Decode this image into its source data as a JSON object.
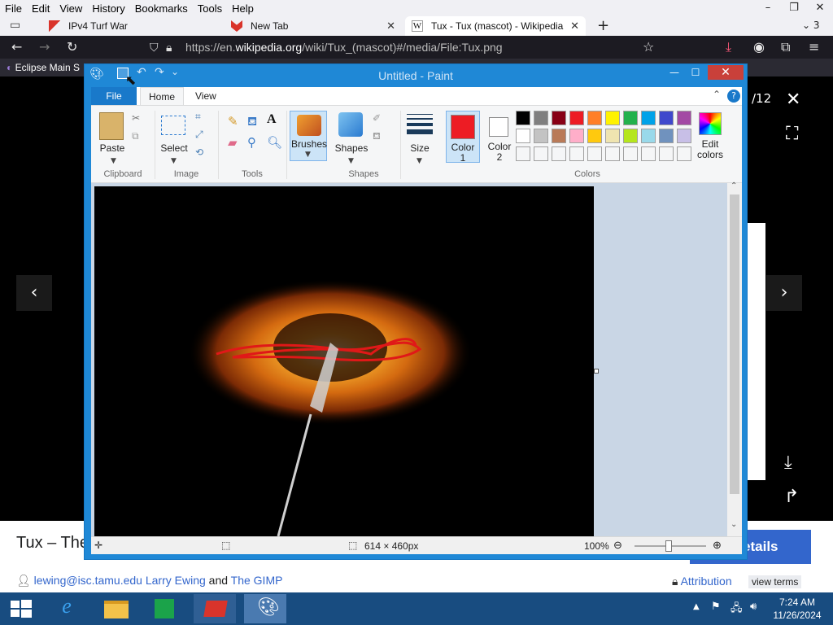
{
  "firefox": {
    "menu": [
      "File",
      "Edit",
      "View",
      "History",
      "Bookmarks",
      "Tools",
      "Help"
    ],
    "window_controls": [
      "–",
      "❐",
      "✕"
    ],
    "tab_count": "3",
    "tabs": [
      {
        "title": "IPv4 Turf War",
        "favicon_color": "#d9342b"
      },
      {
        "title": "New Tab",
        "favicon_color": "#d9342b"
      },
      {
        "title": "Tux - Tux (mascot) - Wikipedia",
        "favicon": "W"
      }
    ],
    "url": {
      "prefix": "https://en.",
      "domain": "wikipedia.org",
      "path": "/wiki/Tux_(mascot)#/media/File:Tux.png"
    },
    "bookmark": "Eclipse Main S"
  },
  "viewer": {
    "counter": "/12",
    "page_title": "Tux – The",
    "details_button": "e details",
    "credit_email": "lewing@isc.tamu.edu",
    "credit_author": "Larry Ewing",
    "credit_and": "and",
    "credit_tool": "The GIMP",
    "attribution": "Attribution",
    "view_terms": "view terms"
  },
  "paint": {
    "title": "Untitled - Paint",
    "tabs": {
      "file": "File",
      "home": "Home",
      "view": "View"
    },
    "groups": {
      "clipboard": "Clipboard",
      "image": "Image",
      "tools": "Tools",
      "shapes": "Shapes",
      "colors": "Colors"
    },
    "buttons": {
      "paste": "Paste",
      "select": "Select",
      "brushes": "Brushes",
      "shapes": "Shapes",
      "size": "Size",
      "color1_a": "Color",
      "color1_b": "1",
      "color2_a": "Color",
      "color2_b": "2",
      "edit_colors_a": "Edit",
      "edit_colors_b": "colors"
    },
    "color1": "#ed1c24",
    "color2": "#ffffff",
    "palette_row1": [
      "#000000",
      "#7f7f7f",
      "#880015",
      "#ed1c24",
      "#ff7f27",
      "#fff200",
      "#22b14c",
      "#00a2e8",
      "#3f48cc",
      "#a349a4"
    ],
    "palette_row2": [
      "#ffffff",
      "#c3c3c3",
      "#b97a57",
      "#ffaec9",
      "#ffc90e",
      "#efe4b0",
      "#b5e61d",
      "#99d9ea",
      "#7092be",
      "#c8bfe7"
    ],
    "status": {
      "dimensions": "614 × 460px",
      "zoom": "100%"
    }
  },
  "taskbar": {
    "time": "7:24 AM",
    "date": "11/26/2024"
  }
}
